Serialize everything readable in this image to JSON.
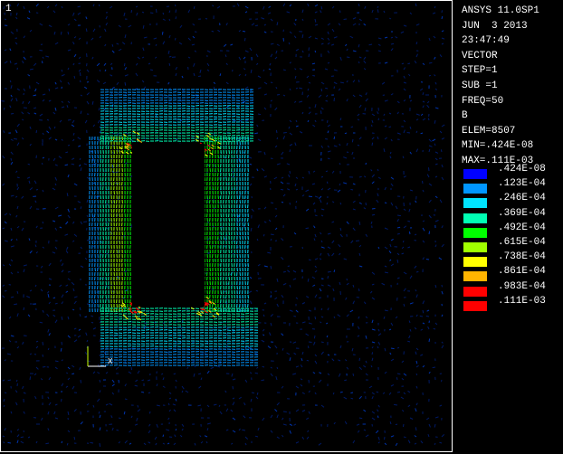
{
  "viewport": {
    "window_number": "1",
    "axis_triad_label": "X"
  },
  "info": {
    "lines": [
      "ANSYS 11.0SP1",
      "JUN  3 2013",
      "23:47:49",
      "VECTOR",
      "STEP=1",
      "SUB =1",
      "FREQ=50",
      "B",
      "ELEM=8507",
      "MIN=.424E-08",
      "MAX=.111E-03"
    ]
  },
  "legend": {
    "entries": [
      {
        "label": ".424E-08",
        "color": "#0000ff"
      },
      {
        "label": ".123E-04",
        "color": "#0096ff"
      },
      {
        "label": ".246E-04",
        "color": "#00e4ff"
      },
      {
        "label": ".369E-04",
        "color": "#00ffb4"
      },
      {
        "label": ".492E-04",
        "color": "#00ff00"
      },
      {
        "label": ".615E-04",
        "color": "#a0ff00"
      },
      {
        "label": ".738E-04",
        "color": "#ffff00"
      },
      {
        "label": ".861E-04",
        "color": "#ffb400"
      },
      {
        "label": ".983E-04",
        "color": "#ff0000"
      },
      {
        "label": ".111E-03",
        "color": "#ff0000"
      }
    ]
  },
  "colors": {
    "background": "#000000",
    "text": "#ffffff",
    "frame": "#ffffff",
    "sparse_vectors": "#001a66"
  }
}
